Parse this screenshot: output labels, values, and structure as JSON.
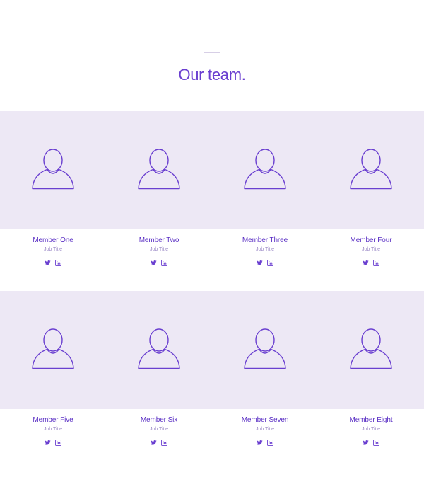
{
  "header": {
    "title": "Our team."
  },
  "colors": {
    "accent": "#6a3fd0",
    "band": "#ede8f5"
  },
  "members": [
    {
      "name": "Member One",
      "job": "Job Title"
    },
    {
      "name": "Member Two",
      "job": "Job Title"
    },
    {
      "name": "Member Three",
      "job": "Job Title"
    },
    {
      "name": "Member Four",
      "job": "Job Title"
    },
    {
      "name": "Member Five",
      "job": "Job Title"
    },
    {
      "name": "Member Six",
      "job": "Job Title"
    },
    {
      "name": "Member Seven",
      "job": "Job Title"
    },
    {
      "name": "Member Eight",
      "job": "Job Title"
    }
  ],
  "icons": [
    "person-icon",
    "twitter-icon",
    "linkedin-icon"
  ]
}
